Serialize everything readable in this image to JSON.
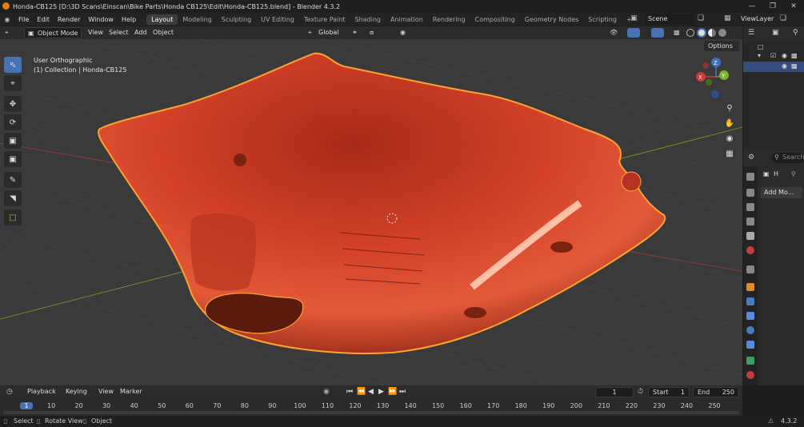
{
  "window": {
    "title": "Honda-CB125 [D:\\3D Scans\\Einscan\\Bike Parts\\Honda CB125\\Edit\\Honda-CB125.blend] - Blender 4.3.2"
  },
  "menu": {
    "file": "File",
    "edit": "Edit",
    "render": "Render",
    "window": "Window",
    "help": "Help"
  },
  "workspaces": [
    "Layout",
    "Modeling",
    "Sculpting",
    "UV Editing",
    "Texture Paint",
    "Shading",
    "Animation",
    "Rendering",
    "Compositing",
    "Geometry Nodes",
    "Scripting"
  ],
  "workspace_add": "+",
  "scene": {
    "label": "Scene",
    "view_layer": "ViewLayer"
  },
  "viewport_header": {
    "mode": "Object Mode",
    "view": "View",
    "select": "Select",
    "add": "Add",
    "object": "Object",
    "orientation": "Global",
    "options": "Options"
  },
  "viewport": {
    "view_name": "User Orthographic",
    "collection": "(1) Collection | Honda-CB125"
  },
  "gizmo": {
    "x": "X",
    "y": "Y",
    "z": "Z"
  },
  "properties": {
    "name_initial": "H",
    "add_modifier": "Add Mo...",
    "search_placeholder": "Search"
  },
  "timeline": {
    "playback": "Playback",
    "keying": "Keying",
    "view": "View",
    "marker": "Marker",
    "current_frame": "1",
    "start_label": "Start",
    "start_value": "1",
    "end_label": "End",
    "end_value": "250",
    "ticks": [
      "1",
      "10",
      "20",
      "30",
      "40",
      "50",
      "60",
      "70",
      "80",
      "90",
      "100",
      "110",
      "120",
      "130",
      "140",
      "150",
      "160",
      "170",
      "180",
      "190",
      "200",
      "210",
      "220",
      "230",
      "240",
      "250"
    ]
  },
  "status_bar": {
    "select": "Select",
    "rotate": "Rotate View",
    "object": "Object",
    "version": "4.3.2"
  },
  "colors": {
    "accent": "#4772b3",
    "object": "#d4402a",
    "outline": "#ffa033",
    "viewport_bg": "#3a3a3a",
    "active_ws": "#3d3d3d"
  }
}
